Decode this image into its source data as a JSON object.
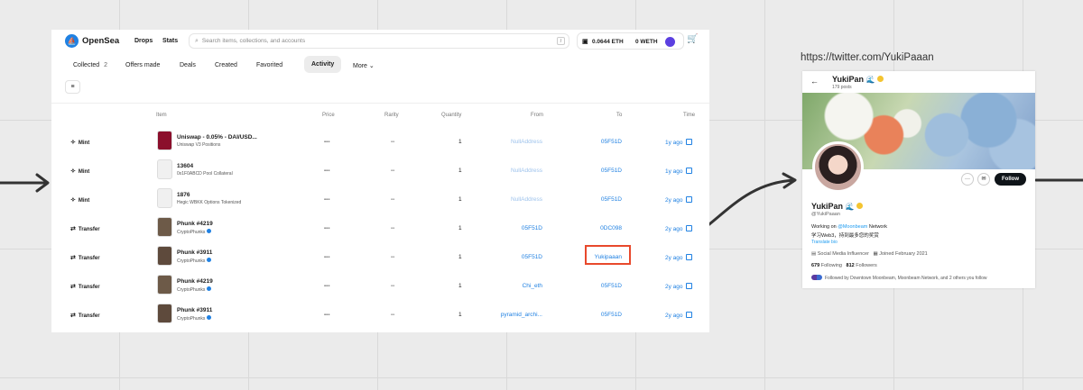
{
  "opensea": {
    "brand": "OpenSea",
    "nav": [
      "Drops",
      "Stats"
    ],
    "search_placeholder": "Search items, collections, and accounts",
    "search_key": "/",
    "eth": "0.0644 ETH",
    "weth": "0 WETH",
    "tabs": [
      {
        "label": "Collected",
        "count": "2"
      },
      {
        "label": "Offers made"
      },
      {
        "label": "Deals"
      },
      {
        "label": "Created"
      },
      {
        "label": "Favorited"
      },
      {
        "label": "Activity"
      },
      {
        "label": "More"
      }
    ],
    "columns": [
      "Item",
      "Price",
      "Rarity",
      "Quantity",
      "From",
      "To",
      "Time"
    ],
    "rows": [
      {
        "event": "Mint",
        "name": "Uniswap - 0.05% - DAI/USD...",
        "sub": "Uniswap V3 Positions",
        "price": "---",
        "rarity": "--",
        "qty": "1",
        "from": "NullAddress",
        "to": "05F51D",
        "time": "1y ago",
        "thumb": "#8b0f2c"
      },
      {
        "event": "Mint",
        "name": "13604",
        "sub": "0x1F0ABCD Pool Collateral",
        "price": "---",
        "rarity": "--",
        "qty": "1",
        "from": "NullAddress",
        "to": "05F51D",
        "time": "1y ago",
        "thumb": "#f0f0f0"
      },
      {
        "event": "Mint",
        "name": "1876",
        "sub": "Hegic WBKK Options Tokenized",
        "price": "---",
        "rarity": "--",
        "qty": "1",
        "from": "NullAddress",
        "to": "05F51D",
        "time": "2y ago",
        "thumb": "#f0f0f0"
      },
      {
        "event": "Transfer",
        "name": "Phunk #4219",
        "sub": "CryptoPhunks",
        "price": "---",
        "rarity": "--",
        "qty": "1",
        "from": "05F51D",
        "to": "0DC098",
        "time": "2y ago",
        "thumb": "#6d5a48"
      },
      {
        "event": "Transfer",
        "name": "Phunk #3911",
        "sub": "CryptoPhunks",
        "price": "---",
        "rarity": "--",
        "qty": "1",
        "from": "05F51D",
        "to": "Yukipaaan",
        "time": "2y ago",
        "thumb": "#5e4a3c"
      },
      {
        "event": "Transfer",
        "name": "Phunk #4219",
        "sub": "CryptoPhunks",
        "price": "---",
        "rarity": "--",
        "qty": "1",
        "from": "Chi_eth",
        "to": "05F51D",
        "time": "2y ago",
        "thumb": "#6d5a48"
      },
      {
        "event": "Transfer",
        "name": "Phunk #3911",
        "sub": "CryptoPhunks",
        "price": "---",
        "rarity": "--",
        "qty": "1",
        "from": "pyramid_archi...",
        "to": "05F51D",
        "time": "2y ago",
        "thumb": "#5e4a3c"
      }
    ]
  },
  "twitter": {
    "url": "https://twitter.com/YukiPaaan",
    "name": "YukiPan",
    "posts": "179 posts",
    "display_name": "YukiPan",
    "handle": "@YukiPaaan",
    "bio_pre": "Working on ",
    "bio_link": "@Moonbeam",
    "bio_post": " Network",
    "bio_line2": "学习Web3，持到最多您的奖赏",
    "translate": "Translate bio",
    "category": "Social Media Influencer",
    "joined": "Joined February 2021",
    "following": "679",
    "following_label": "Following",
    "followers": "812",
    "followers_label": "Followers",
    "followed_by": "Followed by Downtown Moonbeam, Moonbeam Network, and 2 others you follow",
    "follow_label": "Follow"
  }
}
